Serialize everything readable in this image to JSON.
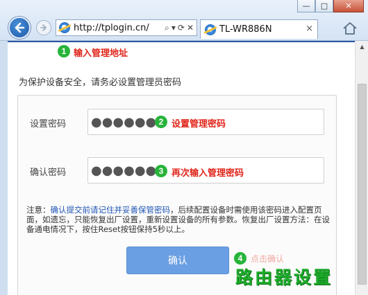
{
  "window": {
    "minimize_glyph": "—",
    "maximize_glyph": "□",
    "close_glyph": "✕"
  },
  "toolbar": {
    "address": "http://tplogin.cn/",
    "address_tools": [
      "⌕",
      "▾",
      "⟳",
      "✕"
    ],
    "tab_title": "TL-WR886N",
    "tab_close": "×",
    "icons": [
      "back-arrow-icon",
      "forward-arrow-icon",
      "ie-icon",
      "search-icon",
      "refresh-icon",
      "home-icon"
    ]
  },
  "steps": {
    "step1": {
      "number": "1",
      "text": "输入管理地址"
    },
    "step2": {
      "number": "2",
      "text": "设置管理密码"
    },
    "step3": {
      "number": "3",
      "text": "再次输入管理密码"
    },
    "step4": {
      "number": "4"
    }
  },
  "form": {
    "intro": "为保护设备安全，请务必设置管理员密码",
    "set_password_label": "设置密码",
    "set_password_value": "●●●●●●",
    "confirm_password_label": "确认密码",
    "confirm_password_value": "●●●●●●",
    "note_prefix": "注意：",
    "note_link": "确认提交前请记住并妥善保管密码",
    "note_rest": "，后续配置设备时需使用该密码进入配置页面，如遗忘，只能恢复出厂设置，重新设置设备的所有参数。恢复出厂设置方法：在设备通电情况下，按住Reset按钮保持5秒以上。",
    "confirm_button": "确认",
    "ghost_text": "点击确认"
  },
  "watermark": "路由器设置",
  "colors": {
    "accent_red": "#e0261b",
    "badge_green": "#27b43a",
    "button_blue": "#6b9fe3",
    "link_blue": "#1f56b3"
  }
}
